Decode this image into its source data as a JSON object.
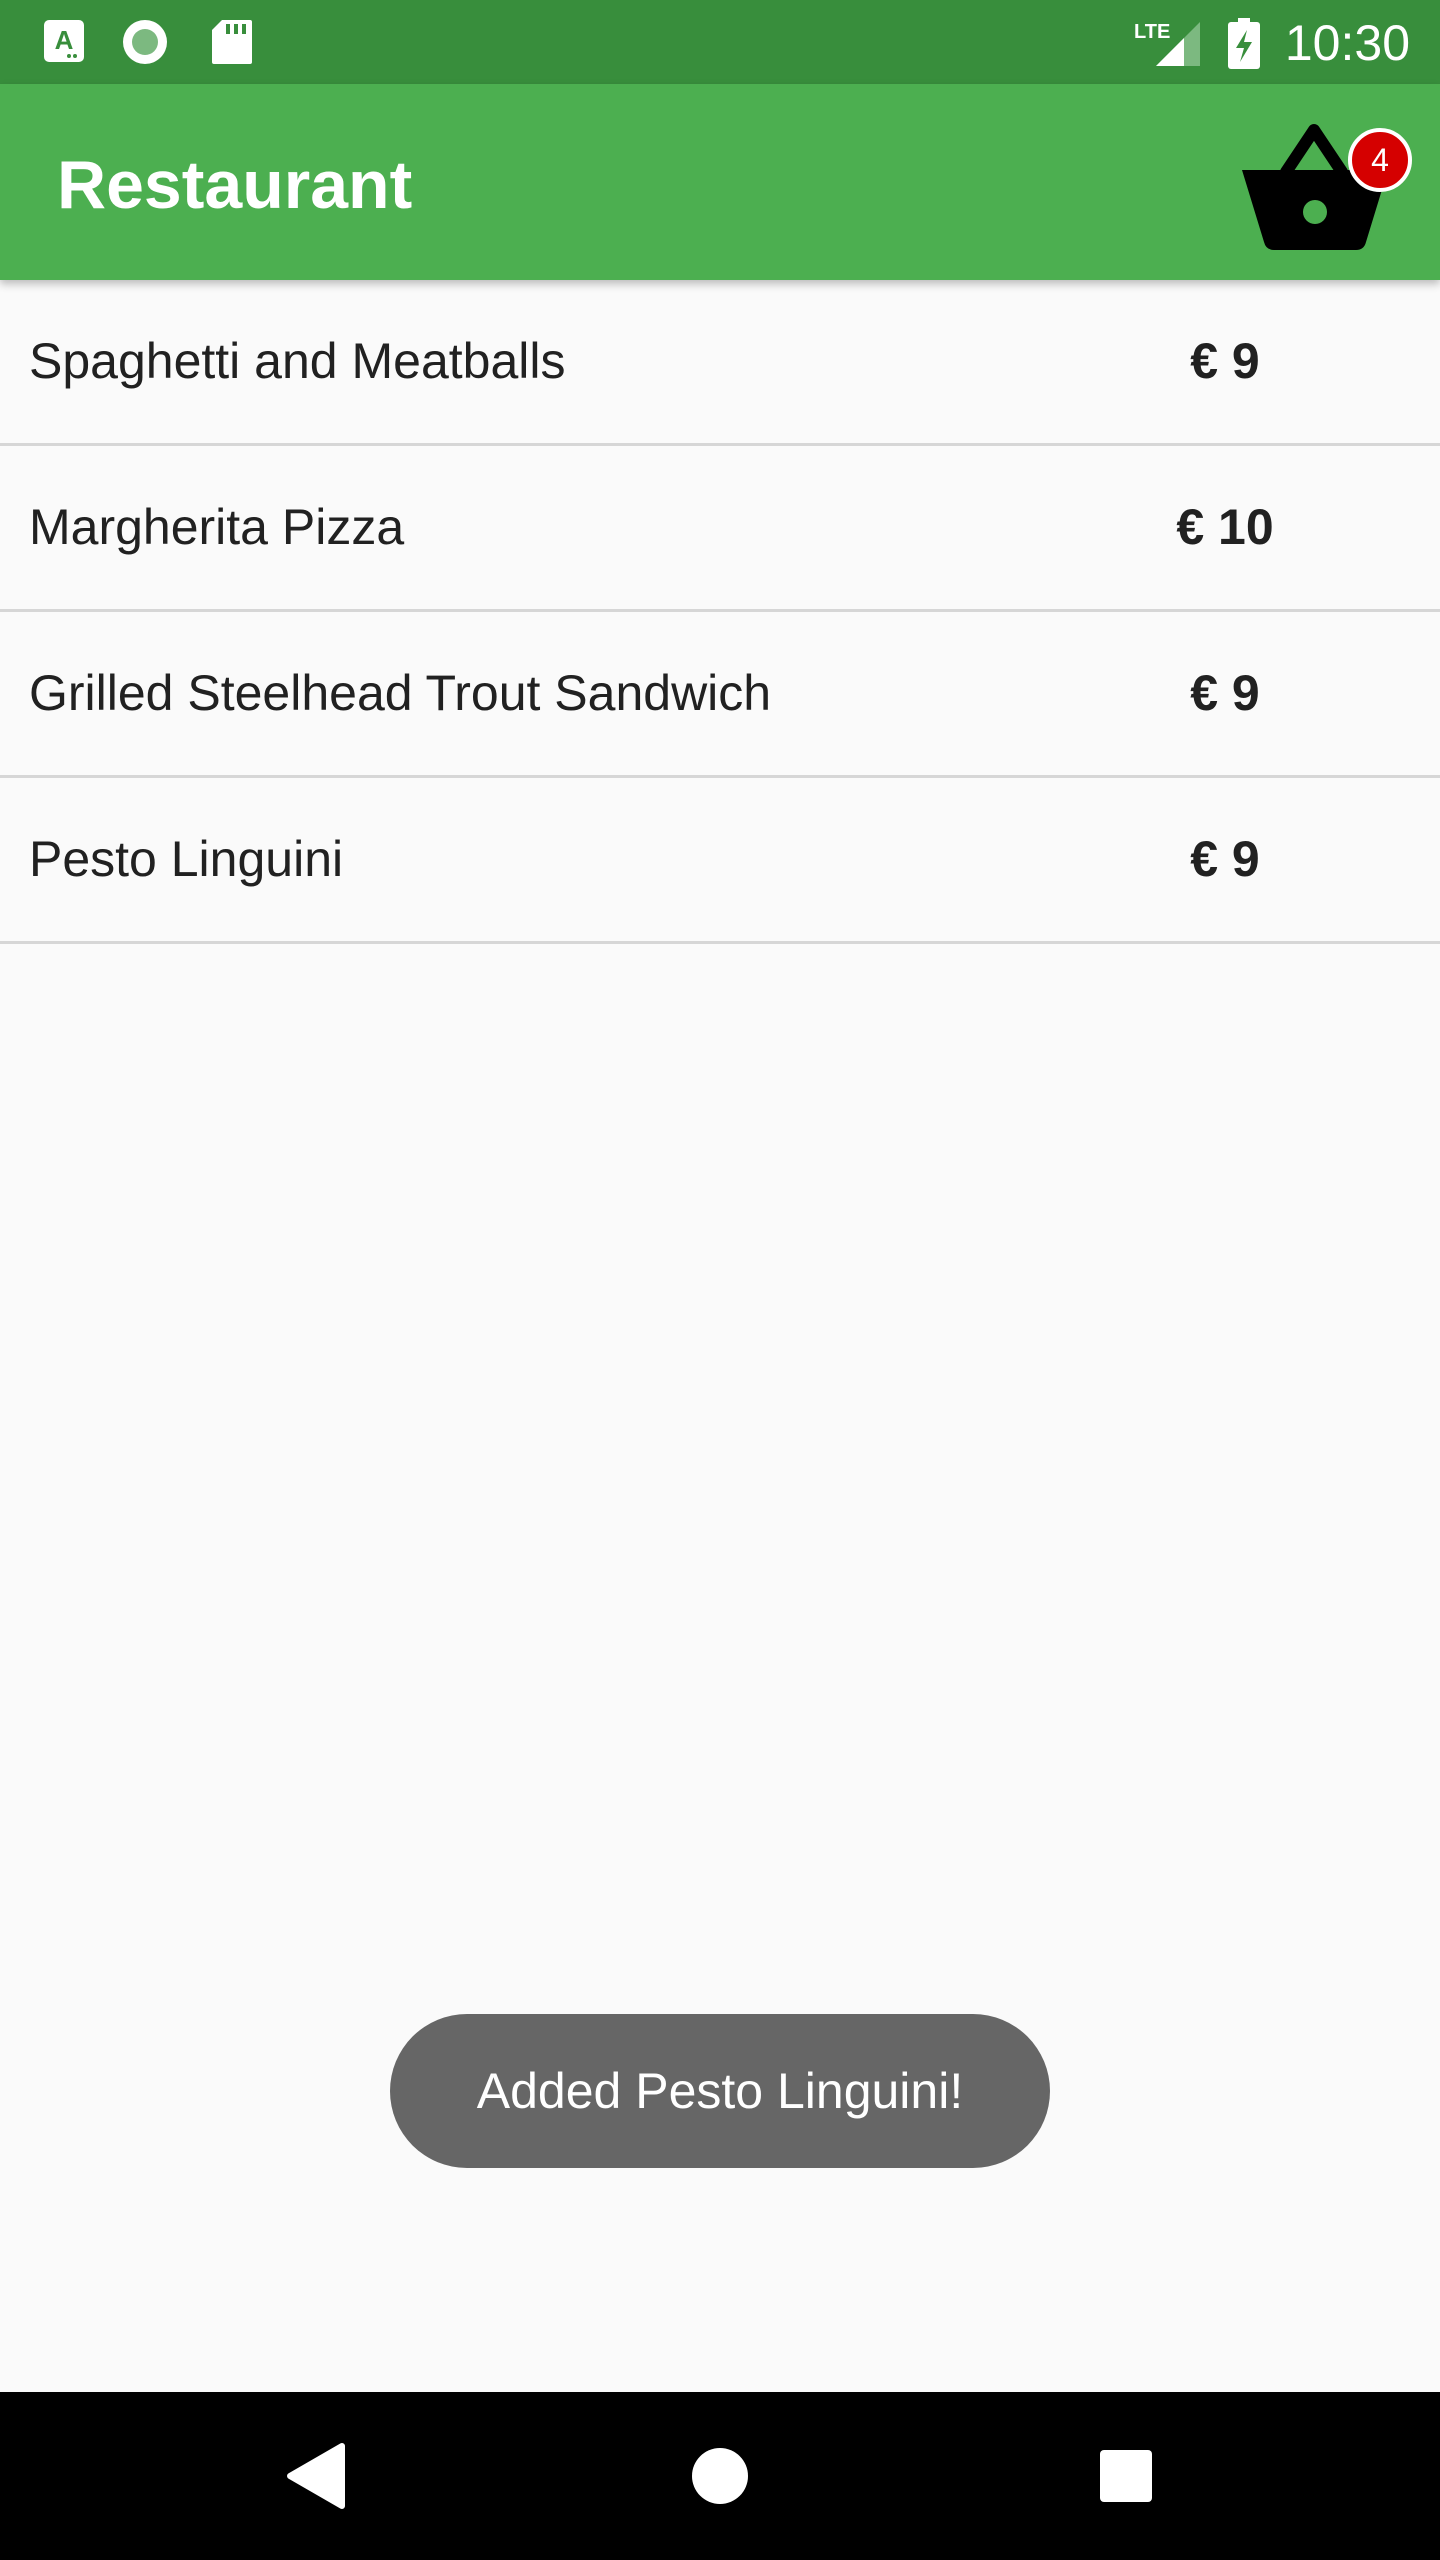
{
  "status_bar": {
    "time": "10:30",
    "icons": [
      "a-notification-icon",
      "record-icon",
      "sd-card-icon",
      "lte-signal-icon",
      "battery-charging-icon"
    ],
    "network": "LTE"
  },
  "app_bar": {
    "title": "Restaurant",
    "cart_icon": "basket-icon",
    "cart_count": "4"
  },
  "menu": {
    "items": [
      {
        "name": "Spaghetti and Meatballs",
        "price": "€ 9"
      },
      {
        "name": "Margherita Pizza",
        "price": "€ 10"
      },
      {
        "name": "Grilled Steelhead Trout Sandwich",
        "price": "€ 9"
      },
      {
        "name": "Pesto Linguini",
        "price": "€ 9"
      }
    ]
  },
  "toast": {
    "message": "Added Pesto Linguini!"
  },
  "nav_bar": {
    "icons": [
      "back-icon",
      "home-icon",
      "recents-icon"
    ]
  },
  "colors": {
    "status_bar": "#388e3c",
    "app_bar": "#4caf50",
    "badge": "#d50000",
    "toast": "#666666",
    "background": "#fafafa"
  }
}
